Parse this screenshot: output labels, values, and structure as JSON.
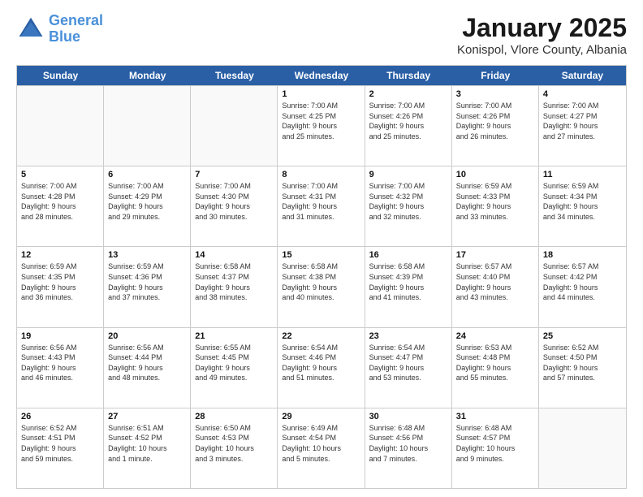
{
  "logo": {
    "line1": "General",
    "line2": "Blue"
  },
  "title": "January 2025",
  "subtitle": "Konispol, Vlore County, Albania",
  "days": [
    "Sunday",
    "Monday",
    "Tuesday",
    "Wednesday",
    "Thursday",
    "Friday",
    "Saturday"
  ],
  "weeks": [
    [
      {
        "day": "",
        "info": ""
      },
      {
        "day": "",
        "info": ""
      },
      {
        "day": "",
        "info": ""
      },
      {
        "day": "1",
        "info": "Sunrise: 7:00 AM\nSunset: 4:25 PM\nDaylight: 9 hours\nand 25 minutes."
      },
      {
        "day": "2",
        "info": "Sunrise: 7:00 AM\nSunset: 4:26 PM\nDaylight: 9 hours\nand 25 minutes."
      },
      {
        "day": "3",
        "info": "Sunrise: 7:00 AM\nSunset: 4:26 PM\nDaylight: 9 hours\nand 26 minutes."
      },
      {
        "day": "4",
        "info": "Sunrise: 7:00 AM\nSunset: 4:27 PM\nDaylight: 9 hours\nand 27 minutes."
      }
    ],
    [
      {
        "day": "5",
        "info": "Sunrise: 7:00 AM\nSunset: 4:28 PM\nDaylight: 9 hours\nand 28 minutes."
      },
      {
        "day": "6",
        "info": "Sunrise: 7:00 AM\nSunset: 4:29 PM\nDaylight: 9 hours\nand 29 minutes."
      },
      {
        "day": "7",
        "info": "Sunrise: 7:00 AM\nSunset: 4:30 PM\nDaylight: 9 hours\nand 30 minutes."
      },
      {
        "day": "8",
        "info": "Sunrise: 7:00 AM\nSunset: 4:31 PM\nDaylight: 9 hours\nand 31 minutes."
      },
      {
        "day": "9",
        "info": "Sunrise: 7:00 AM\nSunset: 4:32 PM\nDaylight: 9 hours\nand 32 minutes."
      },
      {
        "day": "10",
        "info": "Sunrise: 6:59 AM\nSunset: 4:33 PM\nDaylight: 9 hours\nand 33 minutes."
      },
      {
        "day": "11",
        "info": "Sunrise: 6:59 AM\nSunset: 4:34 PM\nDaylight: 9 hours\nand 34 minutes."
      }
    ],
    [
      {
        "day": "12",
        "info": "Sunrise: 6:59 AM\nSunset: 4:35 PM\nDaylight: 9 hours\nand 36 minutes."
      },
      {
        "day": "13",
        "info": "Sunrise: 6:59 AM\nSunset: 4:36 PM\nDaylight: 9 hours\nand 37 minutes."
      },
      {
        "day": "14",
        "info": "Sunrise: 6:58 AM\nSunset: 4:37 PM\nDaylight: 9 hours\nand 38 minutes."
      },
      {
        "day": "15",
        "info": "Sunrise: 6:58 AM\nSunset: 4:38 PM\nDaylight: 9 hours\nand 40 minutes."
      },
      {
        "day": "16",
        "info": "Sunrise: 6:58 AM\nSunset: 4:39 PM\nDaylight: 9 hours\nand 41 minutes."
      },
      {
        "day": "17",
        "info": "Sunrise: 6:57 AM\nSunset: 4:40 PM\nDaylight: 9 hours\nand 43 minutes."
      },
      {
        "day": "18",
        "info": "Sunrise: 6:57 AM\nSunset: 4:42 PM\nDaylight: 9 hours\nand 44 minutes."
      }
    ],
    [
      {
        "day": "19",
        "info": "Sunrise: 6:56 AM\nSunset: 4:43 PM\nDaylight: 9 hours\nand 46 minutes."
      },
      {
        "day": "20",
        "info": "Sunrise: 6:56 AM\nSunset: 4:44 PM\nDaylight: 9 hours\nand 48 minutes."
      },
      {
        "day": "21",
        "info": "Sunrise: 6:55 AM\nSunset: 4:45 PM\nDaylight: 9 hours\nand 49 minutes."
      },
      {
        "day": "22",
        "info": "Sunrise: 6:54 AM\nSunset: 4:46 PM\nDaylight: 9 hours\nand 51 minutes."
      },
      {
        "day": "23",
        "info": "Sunrise: 6:54 AM\nSunset: 4:47 PM\nDaylight: 9 hours\nand 53 minutes."
      },
      {
        "day": "24",
        "info": "Sunrise: 6:53 AM\nSunset: 4:48 PM\nDaylight: 9 hours\nand 55 minutes."
      },
      {
        "day": "25",
        "info": "Sunrise: 6:52 AM\nSunset: 4:50 PM\nDaylight: 9 hours\nand 57 minutes."
      }
    ],
    [
      {
        "day": "26",
        "info": "Sunrise: 6:52 AM\nSunset: 4:51 PM\nDaylight: 9 hours\nand 59 minutes."
      },
      {
        "day": "27",
        "info": "Sunrise: 6:51 AM\nSunset: 4:52 PM\nDaylight: 10 hours\nand 1 minute."
      },
      {
        "day": "28",
        "info": "Sunrise: 6:50 AM\nSunset: 4:53 PM\nDaylight: 10 hours\nand 3 minutes."
      },
      {
        "day": "29",
        "info": "Sunrise: 6:49 AM\nSunset: 4:54 PM\nDaylight: 10 hours\nand 5 minutes."
      },
      {
        "day": "30",
        "info": "Sunrise: 6:48 AM\nSunset: 4:56 PM\nDaylight: 10 hours\nand 7 minutes."
      },
      {
        "day": "31",
        "info": "Sunrise: 6:48 AM\nSunset: 4:57 PM\nDaylight: 10 hours\nand 9 minutes."
      },
      {
        "day": "",
        "info": ""
      }
    ]
  ]
}
